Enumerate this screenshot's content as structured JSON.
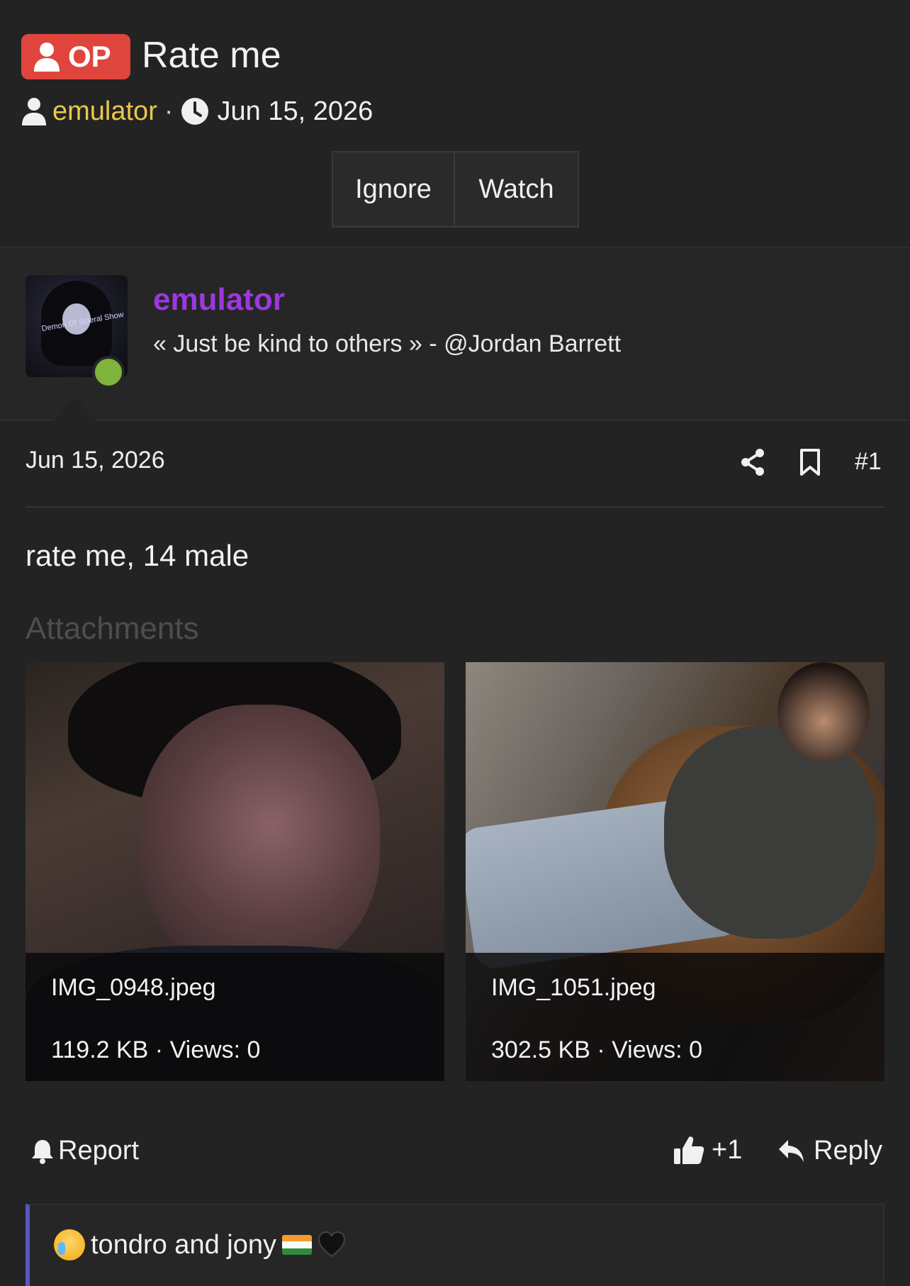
{
  "thread": {
    "op_badge": "OP",
    "title": "Rate me",
    "author": "emulator",
    "separator": "·",
    "date": "Jun 15, 2026",
    "ignore_label": "Ignore",
    "watch_label": "Watch"
  },
  "user": {
    "username": "emulator",
    "signature": "« Just be kind to others » - @Jordan Barrett",
    "avatar_text": "Demon Of Scleral Show",
    "status": "online"
  },
  "post": {
    "date": "Jun 15, 2026",
    "number": "#1",
    "body": "rate me, 14 male",
    "attachments_label": "Attachments",
    "attachments": [
      {
        "name": "IMG_0948.jpeg",
        "meta": "119.2 KB · Views: 0"
      },
      {
        "name": "IMG_1051.jpeg",
        "meta": "302.5 KB · Views: 0"
      }
    ]
  },
  "actions": {
    "report_label": "Report",
    "like_count": "+1",
    "reply_label": "Reply"
  },
  "reactions": {
    "text": "tondro and jony"
  },
  "colors": {
    "op_badge": "#e0453d",
    "author_link": "#e8c84a",
    "username": "#9b38e0",
    "online": "#7fb33a",
    "reaction_accent": "#5a55c2"
  },
  "icons": [
    "user-icon",
    "clock-icon",
    "share-icon",
    "bookmark-icon",
    "bell-icon",
    "thumbs-up-icon",
    "reply-icon"
  ]
}
